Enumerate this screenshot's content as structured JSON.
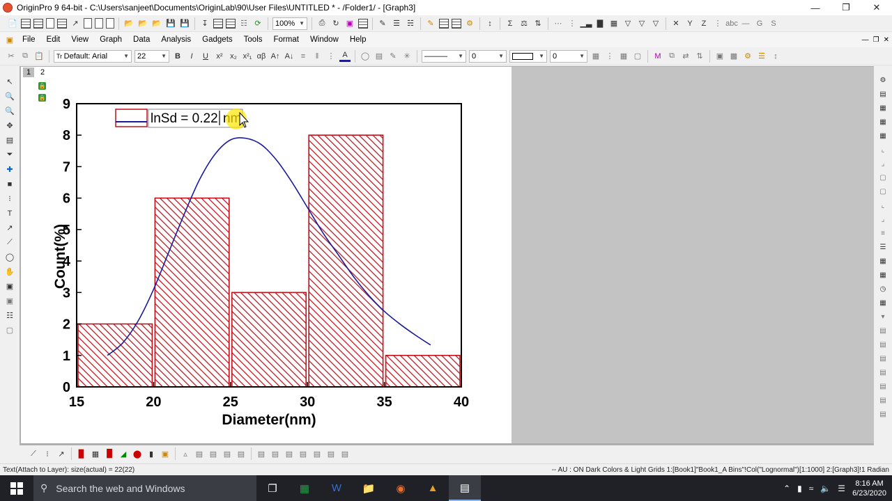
{
  "window": {
    "title": "OriginPro 9 64-bit - C:\\Users\\sanjeet\\Documents\\OriginLab\\90\\User Files\\UNTITLED * - /Folder1/ - [Graph3]",
    "minimize": "—",
    "restore": "❐",
    "close": "✕"
  },
  "toolbar": {
    "zoom": "100%"
  },
  "menu": {
    "items": [
      "File",
      "Edit",
      "View",
      "Graph",
      "Data",
      "Analysis",
      "Gadgets",
      "Tools",
      "Format",
      "Window",
      "Help"
    ]
  },
  "format_toolbar": {
    "font": "Default: Arial",
    "size": "22",
    "bold": "B",
    "italic": "I",
    "underline": "U",
    "superscript": "x²",
    "subscript": "x₂",
    "greek": "αβ",
    "line_width": "0",
    "border_width": "0"
  },
  "layer": {
    "tab": "1",
    "label": "2"
  },
  "chart_data": {
    "type": "bar",
    "bins": [
      {
        "from": 15,
        "to": 20,
        "count": 2
      },
      {
        "from": 20,
        "to": 25,
        "count": 6
      },
      {
        "from": 25,
        "to": 30,
        "count": 3
      },
      {
        "from": 30,
        "to": 35,
        "count": 8
      },
      {
        "from": 35,
        "to": 40,
        "count": 1
      }
    ],
    "fit_curve": {
      "type": "lognormal",
      "x": [
        17,
        18,
        19,
        20,
        21,
        22,
        23,
        24,
        25,
        26,
        27,
        28,
        29,
        30,
        31,
        32,
        33,
        34,
        35,
        36,
        37,
        38
      ],
      "y": [
        1.0,
        1.4,
        2.1,
        3.1,
        4.3,
        5.5,
        6.6,
        7.4,
        7.85,
        7.9,
        7.7,
        7.2,
        6.5,
        5.7,
        4.9,
        4.2,
        3.5,
        2.9,
        2.4,
        2.0,
        1.65,
        1.33
      ]
    },
    "xlabel": "Diameter(nm)",
    "ylabel": "Count(%)",
    "xlim": [
      15,
      40
    ],
    "ylim": [
      0,
      9
    ],
    "xticks": [
      "15",
      "20",
      "25",
      "30",
      "35",
      "40"
    ],
    "yticks": [
      "0",
      "1",
      "2",
      "3",
      "4",
      "5",
      "6",
      "7",
      "8",
      "9"
    ],
    "legend_text": "lnSd = 0.22",
    "legend_cursor_text": "nm",
    "bar_color": "#c0101a",
    "curve_color": "#1a1a9a",
    "grid": false
  },
  "status": {
    "left": "Text(Attach to Layer): size(actual) = 22(22)",
    "right": "-- AU : ON  Dark Colors & Light Grids  1:[Book1]\"Book1_A Bins\"!Col(\"Lognormal\")[1:1000]  2:[Graph3]!1  Radian"
  },
  "taskbar": {
    "search_placeholder": "Search the web and Windows",
    "time": "8:16 AM",
    "date": "6/23/2020"
  }
}
